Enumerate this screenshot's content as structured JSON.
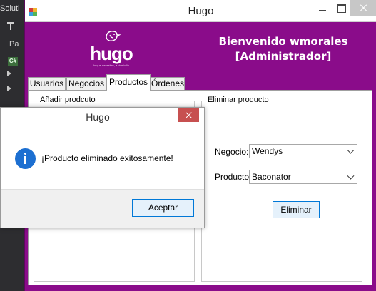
{
  "ide": {
    "title_fragment": "Soluti",
    "item_fragment": "Pa",
    "cs_badge": "C#"
  },
  "window": {
    "title": "Hugo",
    "logo_text": "hugo",
    "logo_tagline": "lo que necesitas, a domicilio",
    "welcome_line1": "Bienvenido wmorales",
    "welcome_line2": "[Administrador]"
  },
  "tabs": [
    {
      "label": "Usuarios"
    },
    {
      "label": "Negocios"
    },
    {
      "label": "Productos"
    },
    {
      "label": "Órdenes"
    }
  ],
  "add_product": {
    "legend": "Añadir prodcuto"
  },
  "delete_product": {
    "legend": "Eliminar producto",
    "negocio_label": "Negocio:",
    "negocio_value": "Wendys",
    "producto_label": "Producto:",
    "producto_value": "Baconator",
    "button_label": "Eliminar"
  },
  "dialog": {
    "title": "Hugo",
    "message": "¡Producto eliminado exitosamente!",
    "button_label": "Aceptar"
  },
  "colors": {
    "brand_purple": "#8a0c8a",
    "info_blue": "#1c6fd1",
    "close_red": "#c75050"
  }
}
